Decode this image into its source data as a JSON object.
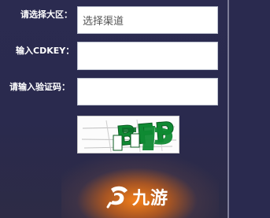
{
  "form": {
    "region_label": "请选择大区：",
    "region_placeholder": "选择渠道",
    "cdkey_label": "输入CDKEY：",
    "cdkey_value": "",
    "captcha_label": "请输入验证码：",
    "captcha_value": ""
  },
  "captcha_text": "BFP",
  "brand": {
    "name": "九游",
    "icon": "jiuyou-logo-icon"
  },
  "colors": {
    "background": "#2a2a4f",
    "accent": "#ff8a1f",
    "field_bg": "#ffffff",
    "captcha_green": "#0f8a33"
  }
}
